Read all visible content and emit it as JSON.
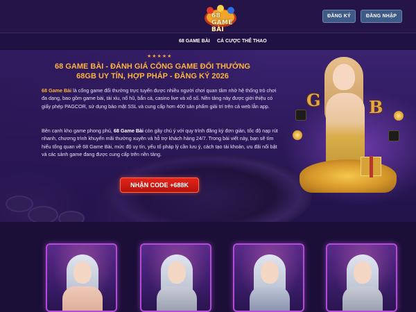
{
  "header": {
    "logo": {
      "text": "68 GAME BÀI"
    },
    "register_label": "ĐĂNG KÝ",
    "login_label": "ĐĂNG NHẬP"
  },
  "nav": {
    "items": [
      {
        "label": "68 GAME BÀI"
      },
      {
        "label": "CÁ CƯỢC THỂ THAO"
      }
    ]
  },
  "hero": {
    "stars": "★★★★★",
    "title_line1": "68 GAME BÀI - ĐÁNH GIÁ CỔNG GAME ĐỔI THƯỞNG",
    "title_line2": "68GB UY TÍN, HỢP PHÁP - ĐĂNG KÝ 2026",
    "p1_strong": "68 Game Bài",
    "p1_text": " là cổng game đổi thưởng trực tuyến được nhiều người chơi quan tâm nhờ hệ thống trò chơi đa dạng, bao gồm game bài, tài xỉu, nổ hũ, bắn cá, casino live và xổ số. Nền tảng này được giới thiệu có giấy phép PAGCOR, sử dụng bảo mật SSL và cung cấp hơn 400 sản phẩm giải trí trên cả web lẫn app.",
    "p2_pre": "Bên cạnh kho game phong phú, ",
    "p2_strong": "68 Game Bài",
    "p2_text": " còn gây chú ý với quy trình đăng ký đơn giản, tốc độ nạp rút nhanh, chương trình khuyến mãi thường xuyên và hỗ trợ khách hàng 24/7. Trong bài viết này, bạn sẽ tìm hiểu tổng quan về 68 Game Bài, mức độ uy tín, yếu tố pháp lý cần lưu ý, cách tạo tài khoản, ưu đãi nổi bật và các sảnh game đang được cung cấp trên nền tảng.",
    "cta_label": "NHẬN CODE +688K"
  },
  "colors": {
    "background": "#1c0f3a",
    "accent_gold": "#ffb43d",
    "cta_red": "#d01a12",
    "card_border": "#b34bd8",
    "button_blue": "#3e5a86"
  },
  "cards": [
    {
      "name": "card-1"
    },
    {
      "name": "card-2"
    },
    {
      "name": "card-3"
    },
    {
      "name": "card-4"
    }
  ]
}
